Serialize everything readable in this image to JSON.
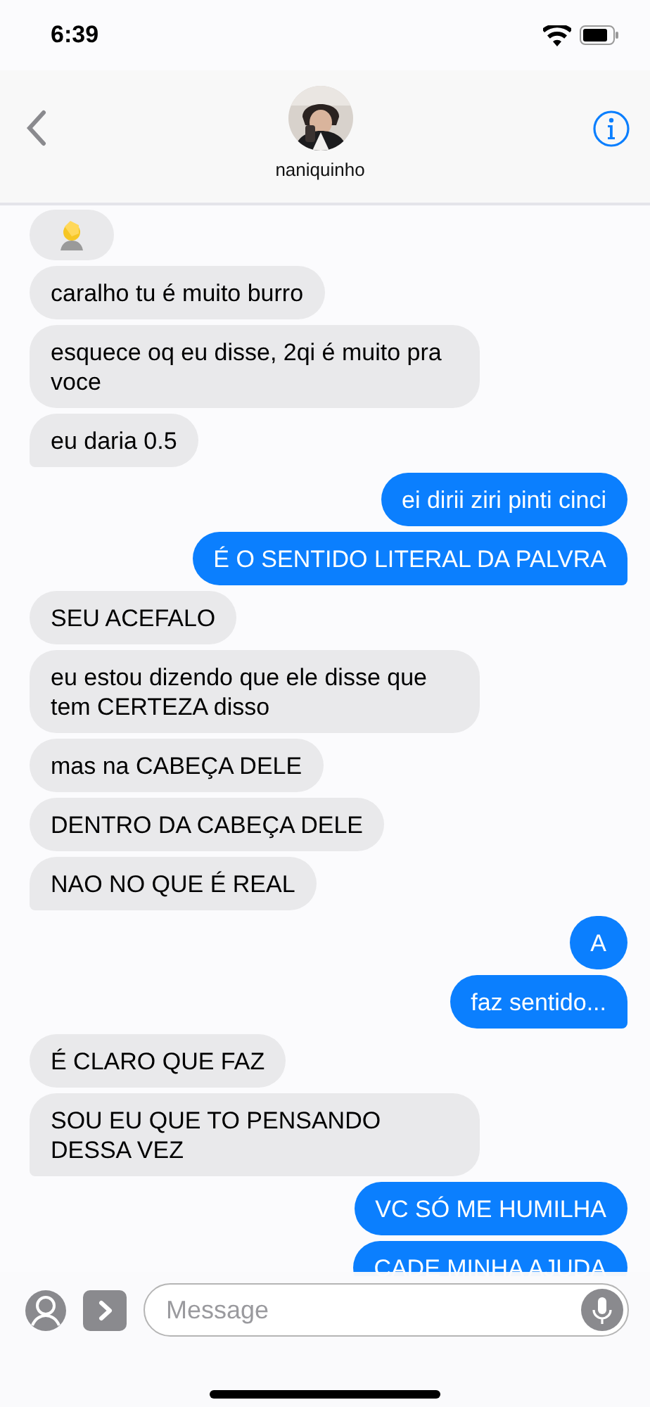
{
  "status_bar": {
    "time": "6:39"
  },
  "header": {
    "contact_name": "naniquinho"
  },
  "messages": [
    {
      "kind": "emoji",
      "sent": false,
      "tail": false
    },
    {
      "kind": "text",
      "sent": false,
      "text": "caralho tu é muito burro",
      "tail": false
    },
    {
      "kind": "text",
      "sent": false,
      "text": "esquece oq eu disse, 2qi é muito pra voce",
      "tail": false
    },
    {
      "kind": "text",
      "sent": false,
      "text": "eu daria 0.5",
      "tail": true
    },
    {
      "kind": "text",
      "sent": true,
      "text": "ei dirii ziri pinti cinci",
      "tail": false
    },
    {
      "kind": "text",
      "sent": true,
      "text": "É O SENTIDO LITERAL DA PALVRA",
      "tail": true
    },
    {
      "kind": "text",
      "sent": false,
      "text": "SEU ACEFALO",
      "tail": false
    },
    {
      "kind": "text",
      "sent": false,
      "text": "eu estou dizendo que ele disse que tem CERTEZA disso",
      "tail": false
    },
    {
      "kind": "text",
      "sent": false,
      "text": "mas na CABEÇA DELE",
      "tail": false
    },
    {
      "kind": "text",
      "sent": false,
      "text": "DENTRO DA CABEÇA DELE",
      "tail": false
    },
    {
      "kind": "text",
      "sent": false,
      "text": "NAO NO QUE É REAL",
      "tail": true
    },
    {
      "kind": "text",
      "sent": true,
      "text": "A",
      "tail": false
    },
    {
      "kind": "text",
      "sent": true,
      "text": "faz sentido...",
      "tail": true
    },
    {
      "kind": "text",
      "sent": false,
      "text": "É CLARO QUE FAZ",
      "tail": false
    },
    {
      "kind": "text",
      "sent": false,
      "text": "SOU EU QUE TO PENSANDO DESSA VEZ",
      "tail": true
    },
    {
      "kind": "text",
      "sent": true,
      "text": "VC SÓ ME HUMILHA",
      "tail": false
    },
    {
      "kind": "text",
      "sent": true,
      "text": "CADE MINHA AJUDA"
    }
  ],
  "composer": {
    "placeholder": "Message"
  }
}
